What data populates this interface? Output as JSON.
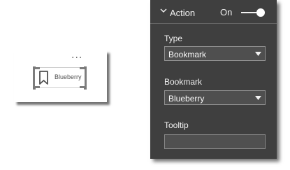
{
  "canvas": {
    "more_options": "...",
    "bookmark_button": {
      "label": "Blueberry",
      "icon": "bookmark-icon"
    }
  },
  "format_pane": {
    "section": {
      "title": "Action",
      "toggle_label": "On",
      "toggle_state": true,
      "icon": "chevron-down-icon"
    },
    "fields": {
      "type": {
        "label": "Type",
        "value": "Bookmark",
        "icon": "chevron-down-icon"
      },
      "bookmark": {
        "label": "Bookmark",
        "value": "Blueberry",
        "icon": "chevron-down-icon"
      },
      "tooltip": {
        "label": "Tooltip",
        "value": ""
      }
    }
  },
  "colors": {
    "pane_bg": "#3f3f3f",
    "pane_text": "#f0f0f0",
    "input_bg": "#4f4f4f",
    "selection_frame": "#7d7d7d"
  }
}
